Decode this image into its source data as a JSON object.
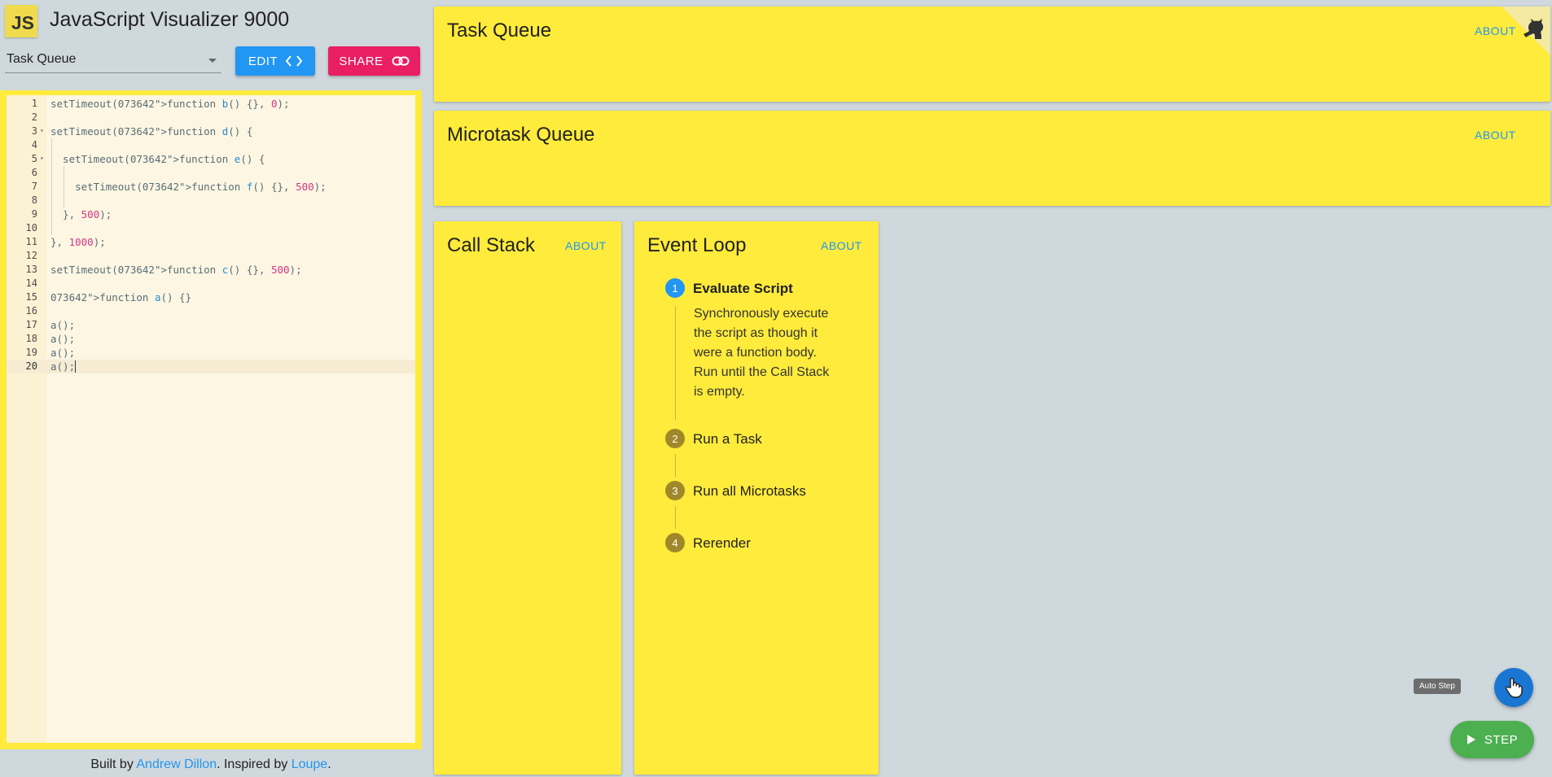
{
  "header": {
    "logo_text": "JS",
    "title": "JavaScript Visualizer 9000",
    "example_select": "Task Queue",
    "edit_label": "EDIT",
    "share_label": "SHARE",
    "edit_icon": "code-brackets-icon",
    "share_icon": "link-icon"
  },
  "editor": {
    "lines": [
      {
        "n": "1",
        "text": "setTimeout(function b() {}, 0);"
      },
      {
        "n": "2",
        "text": ""
      },
      {
        "n": "3",
        "text": "setTimeout(function d() {"
      },
      {
        "n": "4",
        "text": ""
      },
      {
        "n": "5",
        "text": "  setTimeout(function e() {"
      },
      {
        "n": "6",
        "text": ""
      },
      {
        "n": "7",
        "text": "    setTimeout(function f() {}, 500);"
      },
      {
        "n": "8",
        "text": ""
      },
      {
        "n": "9",
        "text": "  }, 500);"
      },
      {
        "n": "10",
        "text": ""
      },
      {
        "n": "11",
        "text": "}, 1000);"
      },
      {
        "n": "12",
        "text": ""
      },
      {
        "n": "13",
        "text": "setTimeout(function c() {}, 500);"
      },
      {
        "n": "14",
        "text": ""
      },
      {
        "n": "15",
        "text": "function a() {}"
      },
      {
        "n": "16",
        "text": ""
      },
      {
        "n": "17",
        "text": "a();"
      },
      {
        "n": "18",
        "text": "a();"
      },
      {
        "n": "19",
        "text": "a();"
      },
      {
        "n": "20",
        "text": "a();"
      }
    ],
    "active_line": "20"
  },
  "footer": {
    "prefix": "Built by ",
    "author": "Andrew Dillon",
    "middle": ". Inspired by ",
    "inspiration": "Loupe",
    "suffix": "."
  },
  "panels": {
    "task_queue": {
      "title": "Task Queue",
      "about": "ABOUT"
    },
    "microtask_queue": {
      "title": "Microtask Queue",
      "about": "ABOUT"
    },
    "call_stack": {
      "title": "Call Stack",
      "about": "ABOUT"
    },
    "event_loop": {
      "title": "Event Loop",
      "about": "ABOUT",
      "steps": [
        {
          "num": "1",
          "label": "Evaluate Script",
          "active": true,
          "desc": "Synchronously execute the script as though it were a function body. Run until the Call Stack is empty."
        },
        {
          "num": "2",
          "label": "Run a Task",
          "active": false
        },
        {
          "num": "3",
          "label": "Run all Microtasks",
          "active": false
        },
        {
          "num": "4",
          "label": "Rerender",
          "active": false
        }
      ]
    }
  },
  "controls": {
    "auto_step_tooltip": "Auto Step",
    "auto_step_icon": "hand-pointer-icon",
    "step_label": "STEP",
    "step_icon": "play-icon"
  },
  "colors": {
    "panel": "#ffeb3b",
    "background": "#cfd8dc",
    "edit_button": "#2196f3",
    "share_button": "#e91e63",
    "step_button": "#4caf50",
    "active_step": "#2196f3"
  }
}
